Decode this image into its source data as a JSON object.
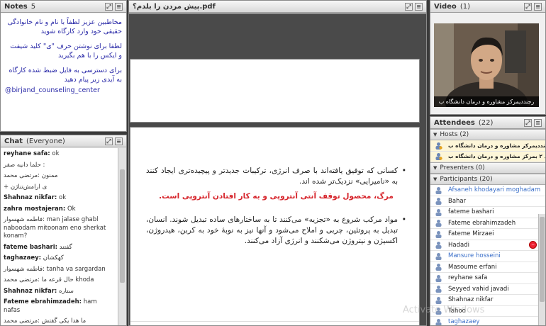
{
  "notes": {
    "title": "Notes",
    "count": "5",
    "paragraphs": [
      "مخاطبین عزیز لطفاً با نام و نام خانوادگی حقیقی خود وارد کارگاه شوید",
      "لطفا برای نوشتن حرف \"ی\" کلید شیفت و ایکس را با هم بگیرید",
      "برای دسترسی به فایل ضبط شده کارگاه به آیدی زیر پیام دهید",
      "@birjand_counseling_center"
    ]
  },
  "chat": {
    "title": "Chat",
    "audience": "(Everyone)",
    "messages": [
      {
        "who": "reyhane safa:",
        "text": "ok"
      },
      {
        "who": "",
        "text": "حلما دانیه صفر :"
      },
      {
        "who": "",
        "text": "ممنون :مرتضی محمد"
      },
      {
        "who": "",
        "text": "+ ی ارامش‌تناژن"
      },
      {
        "who": "Shahnaz nikfar:",
        "text": "ok"
      },
      {
        "who": "zahra mostajeran:",
        "text": "Ok"
      },
      {
        "who": "",
        "text": "فاطمه شهسوار: man jalase ghabl naboodam mitoonam eno sherkat konam?"
      },
      {
        "who": "fateme bashari:",
        "text": "گفتند"
      },
      {
        "who": "taghazaey:",
        "text": "کهکشان"
      },
      {
        "who": "",
        "text": "فاطمه شهسوار: tanha va sargardan"
      },
      {
        "who": "",
        "text": "حال قرعه ما :مرتضی محمد khoda"
      },
      {
        "who": "Shahnaz nikfar:",
        "text": "ستاره"
      },
      {
        "who": "Fateme ebrahimzadeh:",
        "text": "ham nafas"
      },
      {
        "who": "",
        "text": "ما هدا یکی گفتش :مرتضی محمد"
      }
    ]
  },
  "share": {
    "title": "پیش مردن را بلدم؟.pdf",
    "bullet1": "کسانی که توفیق یافته‌اند با صرف انرژی، ترکیبات جدیدتر و پیچیده‌تری ایجاد کنند به «نامیرایی» نزدیک‌تر شده اند.",
    "red_line": "مرگ، محصول توقف آنتی آنتروپی و به کار افتادن آنتروپی است.",
    "bullet2": "مواد مرکب شروع به «تجزیه» می‌کنند تا به ساختارهای ساده تبدیل شوند. انسان، تبدیل به پروتئین، چربی و املاح می‌شود و آنها نیز به نوبهٔ خود به کربن، هیدروژن، اکسیژن و نیتروژن می‌شکنند و انرژی آزاد می‌کنند."
  },
  "video": {
    "title": "Video",
    "count": "(1)",
    "caption": "رجنددیمرکز مشاوره و درمان دانشگاه ب"
  },
  "attendees": {
    "title": "Attendees",
    "count": "(22)",
    "hosts_label": "Hosts (2)",
    "hosts": [
      "رجنددیمرکز مشاوره و درمان دانشگاه ب",
      "رجند ۲ بمرکز مشاوره و درمان دانشگاه ب"
    ],
    "presenters_label": "Presenters (0)",
    "participants_label": "Participants (20)",
    "participants": [
      {
        "name": "Afsaneh khodayari moghadam",
        "blue": true
      },
      {
        "name": "Bahar",
        "blue": false
      },
      {
        "name": "fateme bashari",
        "blue": false
      },
      {
        "name": "Fateme ebrahimzadeh",
        "blue": false
      },
      {
        "name": "Fateme Mirzaei",
        "blue": false
      },
      {
        "name": "Hadadi",
        "blue": false,
        "flag": true
      },
      {
        "name": "Mansure hosseini",
        "blue": true
      },
      {
        "name": "Masoume erfani",
        "blue": false
      },
      {
        "name": "reyhane safa",
        "blue": false
      },
      {
        "name": "Seyyed vahid javadi",
        "blue": false
      },
      {
        "name": "Shahnaz nikfar",
        "blue": false
      },
      {
        "name": "Tahoo",
        "blue": false
      },
      {
        "name": "taghazaey",
        "blue": true
      }
    ]
  },
  "watermark": "Activate Windows"
}
